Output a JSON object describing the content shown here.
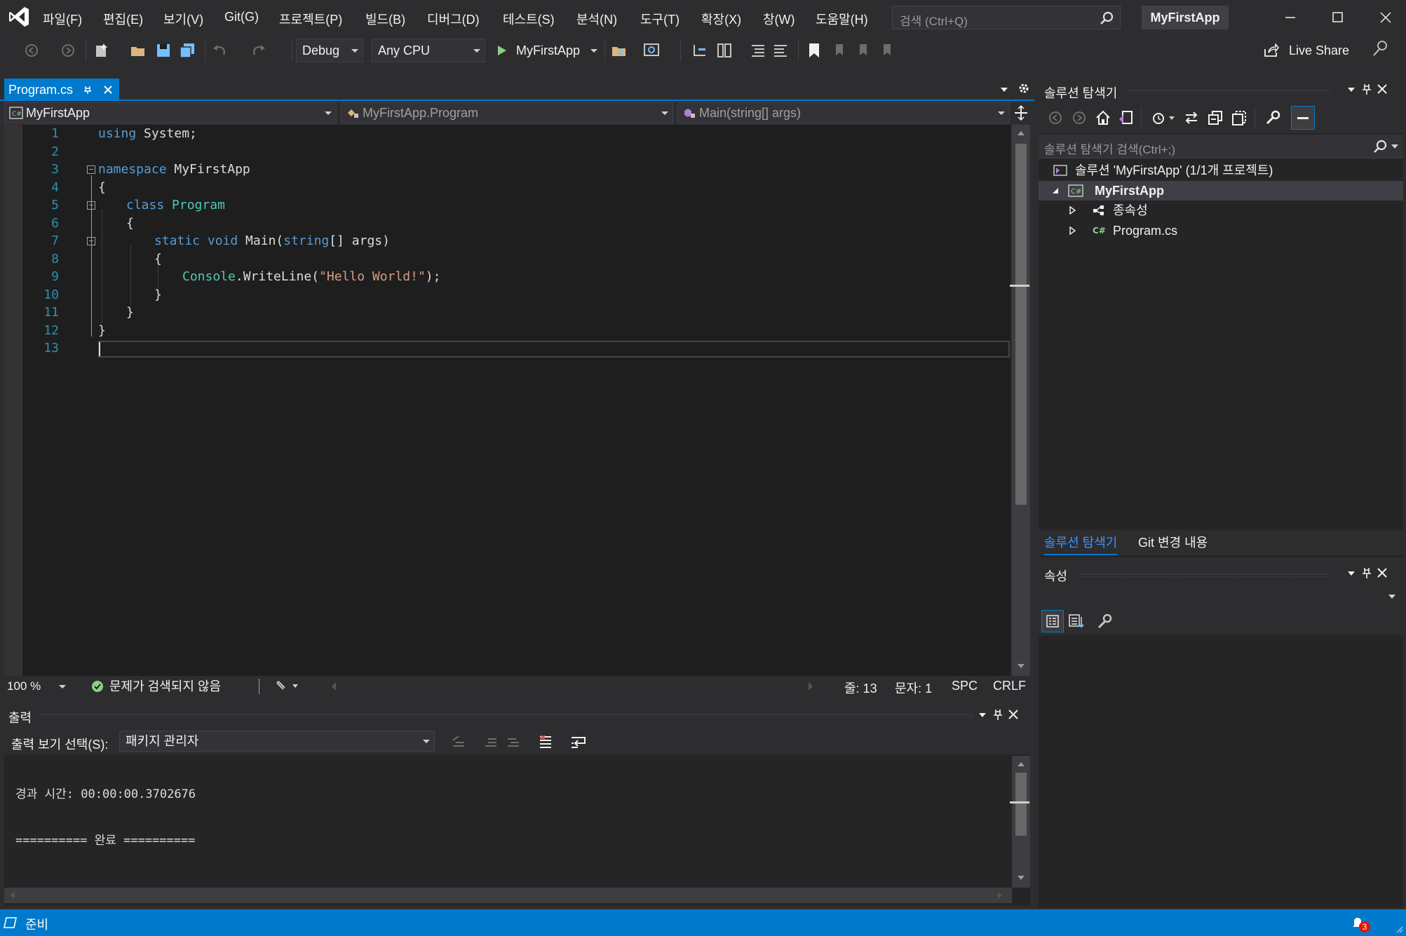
{
  "menu": {
    "items": [
      "파일(F)",
      "편집(E)",
      "보기(V)",
      "Git(G)",
      "프로젝트(P)",
      "빌드(B)",
      "디버그(D)",
      "테스트(S)",
      "분석(N)",
      "도구(T)",
      "확장(X)",
      "창(W)",
      "도움말(H)"
    ],
    "search_placeholder": "검색 (Ctrl+Q)",
    "app_title": "MyFirstApp"
  },
  "toolbar": {
    "configuration": "Debug",
    "platform": "Any CPU",
    "run_target": "MyFirstApp",
    "live_share": "Live Share"
  },
  "editor": {
    "tab_label": "Program.cs",
    "nav_project": "MyFirstApp",
    "nav_class": "MyFirstApp.Program",
    "nav_member": "Main(string[] args)",
    "line_numbers": [
      "1",
      "2",
      "3",
      "4",
      "5",
      "6",
      "7",
      "8",
      "9",
      "10",
      "11",
      "12",
      "13"
    ],
    "code": {
      "l1_kw": "using",
      "l1_rest": " System;",
      "l3_kw": "namespace",
      "l3_rest": " MyFirstApp",
      "l4": "{",
      "l5_kw": "class",
      "l5_type": " Program",
      "l6": "{",
      "l7_kw1": "static",
      "l7_kw2": " void",
      "l7_name": " Main(",
      "l7_kw3": "string",
      "l7_rest": "[] args)",
      "l8": "{",
      "l9_type": "Console",
      "l9_call": ".WriteLine(",
      "l9_str": "\"Hello World!\"",
      "l9_end": ");",
      "l10": "}",
      "l11": "}",
      "l12": "}"
    },
    "zoom": "100 %",
    "issues": "문제가 검색되지 않음",
    "line_info": "줄: 13",
    "col_info": "문자: 1",
    "whitespace": "SPC",
    "line_ending": "CRLF"
  },
  "output": {
    "title": "출력",
    "source_label": "출력 보기 선택(S):",
    "source_value": "패키지 관리자",
    "lines": [
      "경과 시간: 00:00:00.3702676",
      "========== 완료 =========="
    ]
  },
  "solution_explorer": {
    "title": "솔루션 탐색기",
    "search_placeholder": "솔루션 탐색기 검색(Ctrl+;)",
    "solution": "솔루션 'MyFirstApp' (1/1개 프로젝트)",
    "project": "MyFirstApp",
    "dependencies": "종속성",
    "file": "Program.cs",
    "tab_solution": "솔루션 탐색기",
    "tab_git": "Git 변경 내용"
  },
  "properties": {
    "title": "속성"
  },
  "status": {
    "text": "준비",
    "notifications": "3"
  },
  "colors": {
    "accent": "#007acc",
    "keyword": "#569cd6",
    "type": "#4ec9b0",
    "string": "#d69d85",
    "line_number": "#2b91af"
  }
}
